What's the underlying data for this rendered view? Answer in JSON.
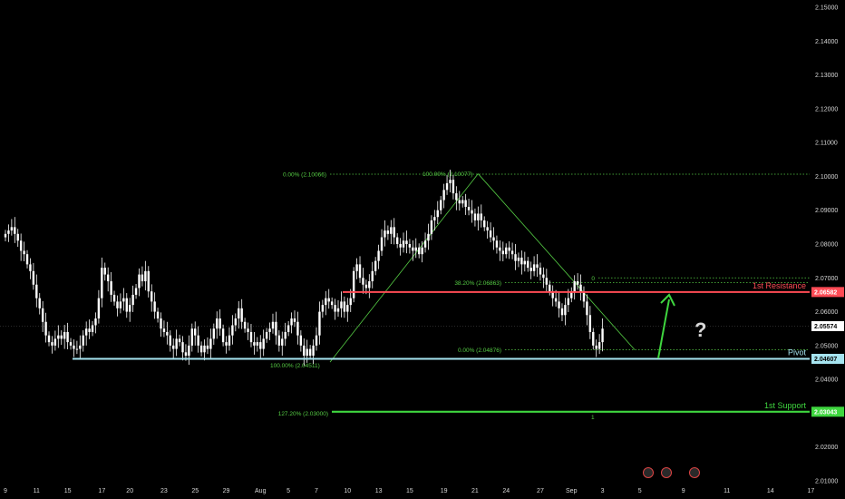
{
  "colors": {
    "background": "#000000",
    "candle": "#ffffff",
    "fib": "#55cc44",
    "resistance": "#ff4b55",
    "pivot": "#a6e4f0",
    "support": "#3fd63f",
    "arrow": "#3fd63f",
    "question": "#d8d8d8"
  },
  "chart_data": {
    "type": "candlestick",
    "ylim": [
      2.01,
      2.15
    ],
    "y_ticks": [
      "2.15000",
      "2.14000",
      "2.13000",
      "2.12000",
      "2.11000",
      "2.10000",
      "2.09000",
      "2.08000",
      "2.07000",
      "2.06000",
      "2.05000",
      "2.04000",
      "2.03000",
      "2.02000",
      "2.01000"
    ],
    "y_tick_values": [
      2.15,
      2.14,
      2.13,
      2.12,
      2.11,
      2.1,
      2.09,
      2.08,
      2.07,
      2.06,
      2.05,
      2.04,
      2.03,
      2.02,
      2.01
    ],
    "x_ticks": [
      "9",
      "11",
      "15",
      "17",
      "20",
      "23",
      "25",
      "29",
      "Aug",
      "5",
      "7",
      "10",
      "13",
      "15",
      "19",
      "21",
      "24",
      "27",
      "Sep",
      "3",
      "5",
      "9",
      "11",
      "14",
      "17"
    ],
    "x_tick_bar_index": [
      0,
      10,
      20,
      31,
      40,
      51,
      61,
      71,
      82,
      91,
      100,
      110,
      120,
      130,
      141,
      151,
      161,
      172,
      182,
      192,
      204,
      218,
      232,
      246,
      259
    ],
    "current_price": "2.05574",
    "current_price_value": 2.05574,
    "closes": [
      2.083,
      2.084,
      2.085,
      2.083,
      2.081,
      2.078,
      2.077,
      2.074,
      2.072,
      2.068,
      2.064,
      2.061,
      2.057,
      2.053,
      2.051,
      2.05,
      2.052,
      2.053,
      2.052,
      2.054,
      2.051,
      2.05,
      2.049,
      2.049,
      2.05,
      2.053,
      2.055,
      2.054,
      2.056,
      2.058,
      2.064,
      2.073,
      2.071,
      2.069,
      2.065,
      2.063,
      2.061,
      2.063,
      2.064,
      2.06,
      2.062,
      2.065,
      2.067,
      2.071,
      2.069,
      2.072,
      2.066,
      2.063,
      2.06,
      2.058,
      2.055,
      2.054,
      2.053,
      2.05,
      2.049,
      2.052,
      2.051,
      2.048,
      2.047,
      2.05,
      2.055,
      2.053,
      2.05,
      2.048,
      2.05,
      2.049,
      2.052,
      2.055,
      2.058,
      2.055,
      2.051,
      2.05,
      2.053,
      2.056,
      2.058,
      2.061,
      2.057,
      2.055,
      2.054,
      2.051,
      2.05,
      2.051,
      2.049,
      2.052,
      2.054,
      2.055,
      2.057,
      2.053,
      2.05,
      2.052,
      2.054,
      2.056,
      2.058,
      2.057,
      2.053,
      2.05,
      2.047,
      2.049,
      2.047,
      2.05,
      2.053,
      2.06,
      2.062,
      2.064,
      2.063,
      2.062,
      2.06,
      2.061,
      2.063,
      2.06,
      2.062,
      2.064,
      2.072,
      2.074,
      2.07,
      2.068,
      2.067,
      2.069,
      2.072,
      2.075,
      2.078,
      2.082,
      2.084,
      2.083,
      2.085,
      2.082,
      2.08,
      2.079,
      2.081,
      2.08,
      2.079,
      2.078,
      2.079,
      2.077,
      2.079,
      2.081,
      2.083,
      2.087,
      2.088,
      2.09,
      2.093,
      2.096,
      2.098,
      2.099,
      2.095,
      2.093,
      2.092,
      2.093,
      2.091,
      2.09,
      2.089,
      2.087,
      2.089,
      2.087,
      2.085,
      2.084,
      2.082,
      2.081,
      2.079,
      2.078,
      2.077,
      2.079,
      2.078,
      2.077,
      2.075,
      2.076,
      2.074,
      2.075,
      2.073,
      2.072,
      2.074,
      2.073,
      2.071,
      2.07,
      2.068,
      2.066,
      2.064,
      2.063,
      2.061,
      2.059,
      2.062,
      2.064,
      2.066,
      2.069,
      2.068,
      2.066,
      2.063,
      2.059,
      2.054,
      2.05,
      2.049,
      2.051,
      2.055
    ],
    "fib_levels": [
      {
        "label": "0.00% (2.10066)",
        "value": 2.10066
      },
      {
        "label": "100.00% (2.10077)",
        "value": 2.10077
      },
      {
        "label": "38.20% (2.06863)",
        "value": 2.06863
      },
      {
        "label": "0.00% (2.04876)",
        "value": 2.04876
      },
      {
        "label": "100.00% (2.04511)",
        "value": 2.04511
      },
      {
        "label": "127.20% (2.03000)",
        "value": 2.03
      },
      {
        "label": "0",
        "value": 2.07
      },
      {
        "label": "1",
        "value": 2.029
      }
    ],
    "levels": [
      {
        "name": "1st Resistance",
        "value": 2.06582,
        "badge": "2.06582"
      },
      {
        "name": "Pivot",
        "value": 2.04607,
        "badge": "2.04607"
      },
      {
        "name": "1st Support",
        "value": 2.03043,
        "badge": "2.03043"
      }
    ],
    "annotations": [
      "?"
    ]
  }
}
